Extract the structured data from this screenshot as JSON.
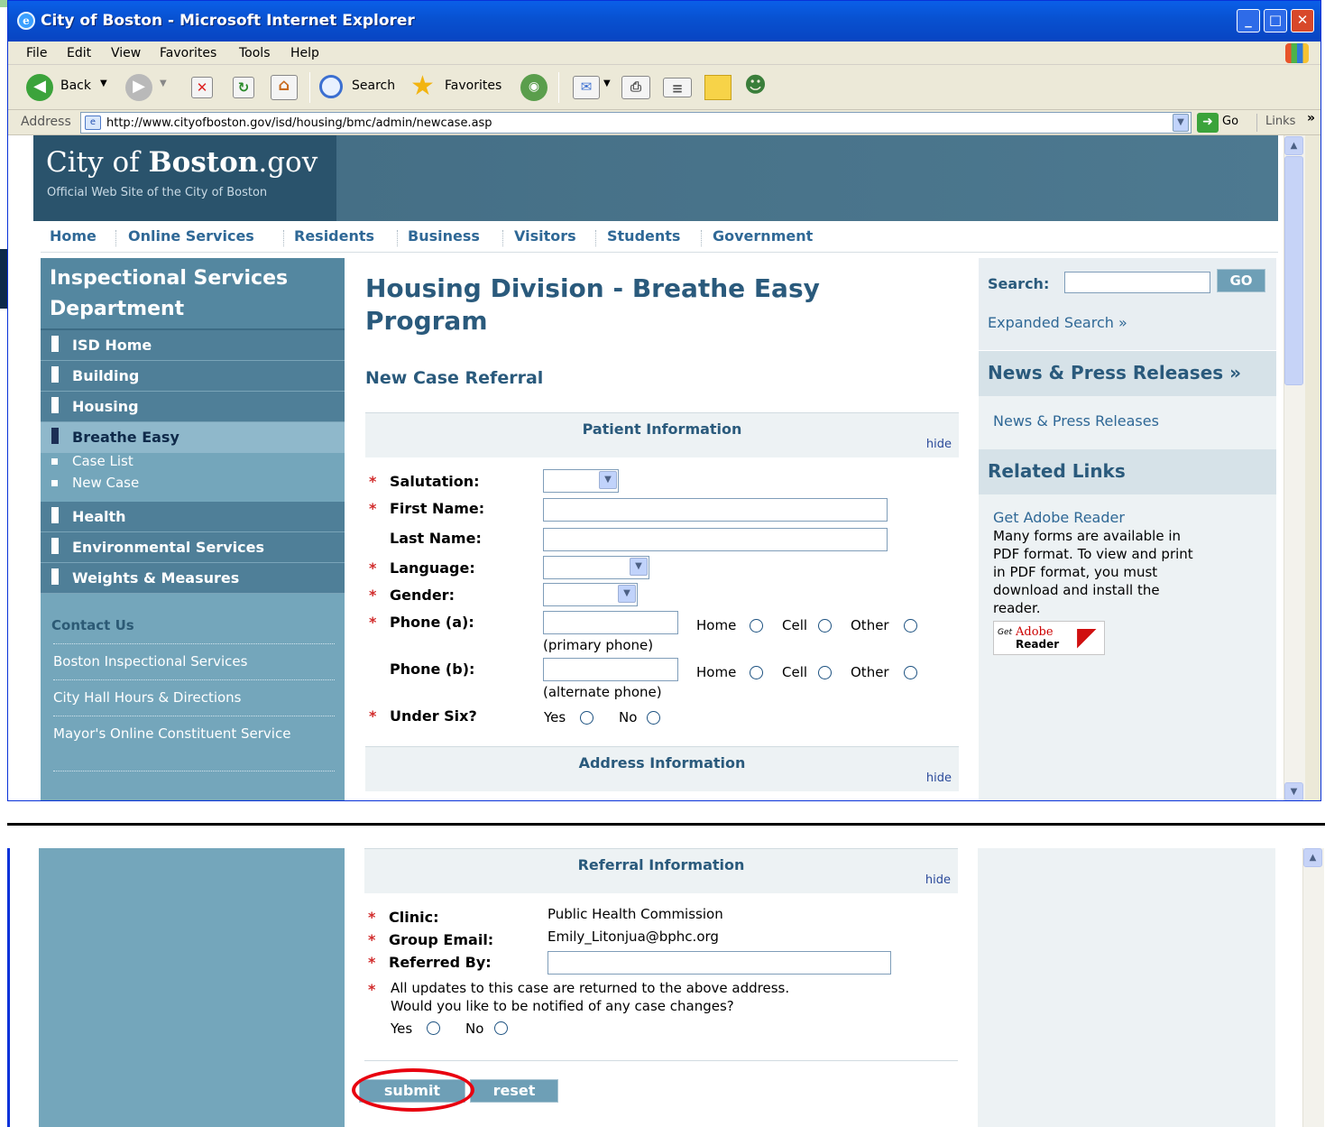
{
  "window": {
    "title": "City of Boston - Microsoft Internet Explorer",
    "controls": {
      "minimize": "_",
      "maximize": "□",
      "close": "✕"
    }
  },
  "menu": [
    "File",
    "Edit",
    "View",
    "Favorites",
    "Tools",
    "Help"
  ],
  "toolbar": {
    "back": "Back",
    "search": "Search",
    "favorites": "Favorites"
  },
  "address": {
    "label": "Address",
    "url": "http://www.cityofboston.gov/isd/housing/bmc/admin/newcase.asp",
    "go": "Go",
    "links": "Links"
  },
  "site": {
    "logo_city": "City",
    "logo_of": "of",
    "logo_boston": "Boston",
    "logo_gov": ".gov",
    "tagline": "Official Web Site of the City of Boston"
  },
  "topnav": [
    "Home",
    "Online Services",
    "Residents",
    "Business",
    "Visitors",
    "Students",
    "Government"
  ],
  "sidebar": {
    "title_line1": "Inspectional Services",
    "title_line2": "Department",
    "items": [
      "ISD Home",
      "Building",
      "Housing"
    ],
    "active": "Breathe Easy",
    "subitems": [
      "Case List",
      "New Case"
    ],
    "items_after": [
      "Health",
      "Environmental Services",
      "Weights & Measures"
    ],
    "contact_head": "Contact Us",
    "contact_links": [
      "Boston Inspectional Services",
      "City Hall Hours & Directions",
      "Mayor's Online Constituent Service"
    ]
  },
  "main": {
    "title_line1": "Housing Division - Breathe Easy",
    "title_line2": "Program",
    "subtitle": "New Case Referral",
    "required_mark": "*",
    "hide_label": "hide",
    "patient_section": "Patient Information",
    "address_section": "Address Information",
    "referral_section": "Referral Information",
    "fields": {
      "salutation": "Salutation:",
      "first_name": "First Name:",
      "last_name": "Last Name:",
      "language": "Language:",
      "gender": "Gender:",
      "phone_a": "Phone (a):",
      "phone_a_hint": "(primary phone)",
      "phone_b": "Phone (b):",
      "phone_b_hint": "(alternate phone)",
      "under_six": "Under Six?",
      "home": "Home",
      "cell": "Cell",
      "other": "Other",
      "yes": "Yes",
      "no": "No"
    },
    "referral": {
      "clinic_label": "Clinic:",
      "clinic_value": "Public Health Commission",
      "email_label": "Group Email:",
      "email_value": "Emily_Litonjua@bphc.org",
      "referred_label": "Referred By:",
      "notice_line1": "All updates to this case are returned to the above address.",
      "notice_line2": "Would you like to be notified of any case changes?",
      "yes": "Yes",
      "no": "No"
    },
    "submit": "submit",
    "reset": "reset"
  },
  "right": {
    "search_label": "Search:",
    "go": "GO",
    "expanded": "Expanded Search »",
    "news_head": "News & Press Releases »",
    "news_link": "News & Press Releases",
    "related_head": "Related Links",
    "adobe_link": "Get Adobe Reader",
    "adobe_text": [
      "Many forms are available in",
      "PDF format. To view and print",
      "in PDF format, you must",
      "download and install the",
      "reader."
    ],
    "adobe_badge_get": "Get",
    "adobe_badge_adobe": "Adobe",
    "adobe_badge_reader": "Reader"
  },
  "colors": {
    "accent": "#2a5a7c",
    "sidebar": "#74a6bb",
    "highlight": "#e8000f"
  }
}
